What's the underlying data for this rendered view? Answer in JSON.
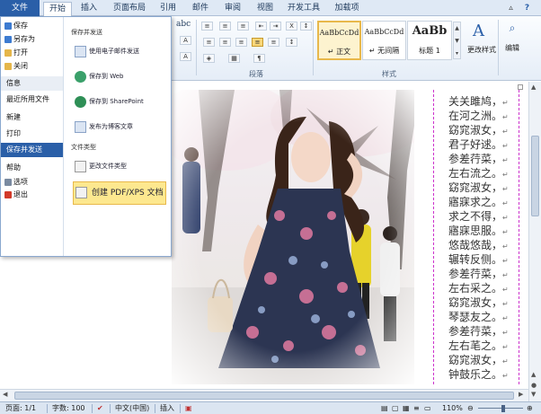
{
  "tabs": {
    "file": "文件",
    "items": [
      "开始",
      "插入",
      "页面布局",
      "引用",
      "邮件",
      "审阅",
      "视图",
      "开发工具",
      "加载项"
    ]
  },
  "ribbon": {
    "groups": {
      "paragraph": "段落",
      "styles": "样式"
    },
    "styles": [
      {
        "preview": "AaBbCcDd",
        "name": "↵ 正文"
      },
      {
        "preview": "AaBbCcDd",
        "name": "↵ 无间隔"
      },
      {
        "preview": "AaBb",
        "name": "标题 1"
      }
    ],
    "change_styles": "更改样式",
    "edit": "编辑",
    "font_sample": "abc"
  },
  "backstage": {
    "menu": {
      "save": "保存",
      "save_as": "另存为",
      "open": "打开",
      "close": "关闭",
      "info": "信息",
      "recent": "最近所用文件",
      "new": "新建",
      "print": "打印",
      "save_send": "保存并发送",
      "help": "帮助",
      "options": "选项",
      "exit": "退出"
    },
    "section_save_send": "保存并发送",
    "options": {
      "email": "使用电子邮件发送",
      "web": "保存到 Web",
      "sharepoint": "保存到 SharePoint",
      "blog": "发布为博客文章"
    },
    "section_file_types": "文件类型",
    "change_type": "更改文件类型",
    "create_pdf": "创建 PDF/XPS 文档"
  },
  "document": {
    "verse": [
      "关关雎鸠，",
      "在河之洲。",
      "窈窕淑女，",
      "君子好逑。",
      "参差荇菜，",
      "左右流之。",
      "窈窕淑女，",
      "寤寐求之。",
      "求之不得，",
      "寤寐思服。",
      "悠哉悠哉，",
      "辗转反侧。",
      "参差荇菜，",
      "左右采之。",
      "窈窕淑女，",
      "琴瑟友之。",
      "参差荇菜，",
      "左右芼之。",
      "窈窕淑女，",
      "钟鼓乐之。"
    ],
    "paragraph_mark": "↵"
  },
  "status": {
    "page": "页面: 1/1",
    "words": "字数: 100",
    "lang": "中文(中国)",
    "mode": "插入",
    "zoom": "110%"
  },
  "colors": {
    "accent": "#2a5fa8",
    "highlight": "#fde88f",
    "arrow": "#e0342a",
    "verse_border": "#cc33cc"
  }
}
